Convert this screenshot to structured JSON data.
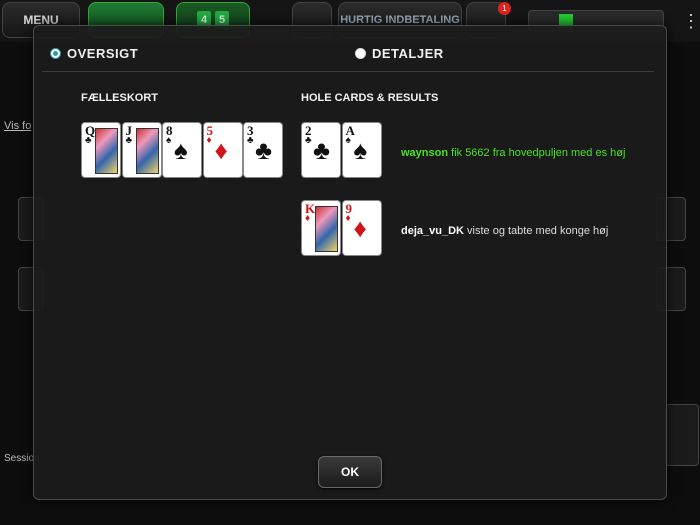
{
  "topbar": {
    "menu_label": "MENU",
    "hole_preview": [
      "4",
      "5"
    ],
    "deposit_label": "HURTIG INDBETALING",
    "notification_count": "1"
  },
  "background": {
    "link_text": "Vis fo",
    "session_text": "Session"
  },
  "dialog": {
    "tabs": [
      {
        "label": "OVERSIGT",
        "selected": true
      },
      {
        "label": "DETALJER",
        "selected": false
      }
    ],
    "community": {
      "heading": "FÆLLESKORT",
      "cards": [
        {
          "rank": "Q",
          "suit": "♣",
          "color": "black"
        },
        {
          "rank": "J",
          "suit": "♣",
          "color": "black"
        },
        {
          "rank": "8",
          "suit": "♠",
          "color": "black"
        },
        {
          "rank": "5",
          "suit": "♦",
          "color": "red"
        },
        {
          "rank": "3",
          "suit": "♣",
          "color": "black"
        }
      ]
    },
    "hole": {
      "heading": "HOLE CARDS & RESULTS",
      "players": [
        {
          "name": "waynson",
          "message": " fik 5662 fra hovedpuljen med es høj",
          "cards": [
            {
              "rank": "2",
              "suit": "♣",
              "color": "black"
            },
            {
              "rank": "A",
              "suit": "♠",
              "color": "black"
            }
          ]
        },
        {
          "name": "deja_vu_DK",
          "message": " viste og tabte med konge høj",
          "cards": [
            {
              "rank": "K",
              "suit": "♦",
              "color": "red"
            },
            {
              "rank": "9",
              "suit": "♦",
              "color": "red"
            }
          ]
        }
      ]
    },
    "ok_label": "OK"
  },
  "colors": {
    "winner": "#47e21f",
    "radio_selected": "#2c9aa8"
  }
}
